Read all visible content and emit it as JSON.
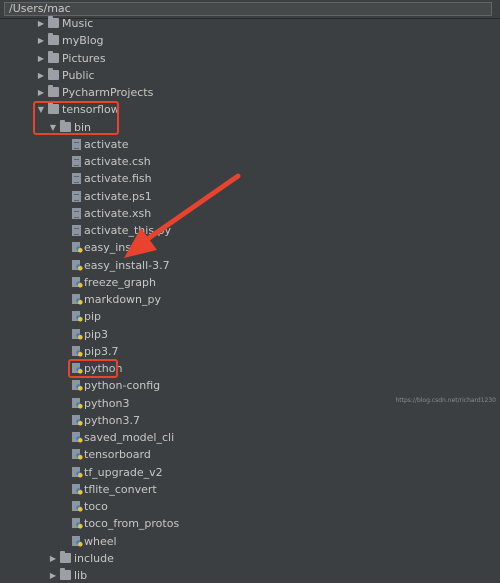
{
  "path_bar": {
    "value": "/Users/mac"
  },
  "tree": {
    "folders_top": [
      "Music",
      "myBlog",
      "Pictures",
      "Public",
      "PycharmProjects"
    ],
    "expanded_folder": "tensorflow",
    "sub_folder": "bin",
    "bin_files": [
      {
        "name": "activate",
        "type": "text"
      },
      {
        "name": "activate.csh",
        "type": "text"
      },
      {
        "name": "activate.fish",
        "type": "text"
      },
      {
        "name": "activate.ps1",
        "type": "text"
      },
      {
        "name": "activate.xsh",
        "type": "text"
      },
      {
        "name": "activate_this.py",
        "type": "text"
      },
      {
        "name": "easy_install",
        "type": "py"
      },
      {
        "name": "easy_install-3.7",
        "type": "py"
      },
      {
        "name": "freeze_graph",
        "type": "py"
      },
      {
        "name": "markdown_py",
        "type": "py"
      },
      {
        "name": "pip",
        "type": "py"
      },
      {
        "name": "pip3",
        "type": "py"
      },
      {
        "name": "pip3.7",
        "type": "py"
      },
      {
        "name": "python",
        "type": "py"
      },
      {
        "name": "python-config",
        "type": "py"
      },
      {
        "name": "python3",
        "type": "py"
      },
      {
        "name": "python3.7",
        "type": "py"
      },
      {
        "name": "saved_model_cli",
        "type": "py"
      },
      {
        "name": "tensorboard",
        "type": "py"
      },
      {
        "name": "tf_upgrade_v2",
        "type": "py"
      },
      {
        "name": "tflite_convert",
        "type": "py"
      },
      {
        "name": "toco",
        "type": "py"
      },
      {
        "name": "toco_from_protos",
        "type": "py"
      },
      {
        "name": "wheel",
        "type": "py"
      }
    ],
    "folders_bottom": [
      "include",
      "lib"
    ]
  },
  "colors": {
    "highlight": "#e8432f",
    "background": "#3c3f41"
  },
  "watermark": "https://blog.csdn.net/richard1230"
}
